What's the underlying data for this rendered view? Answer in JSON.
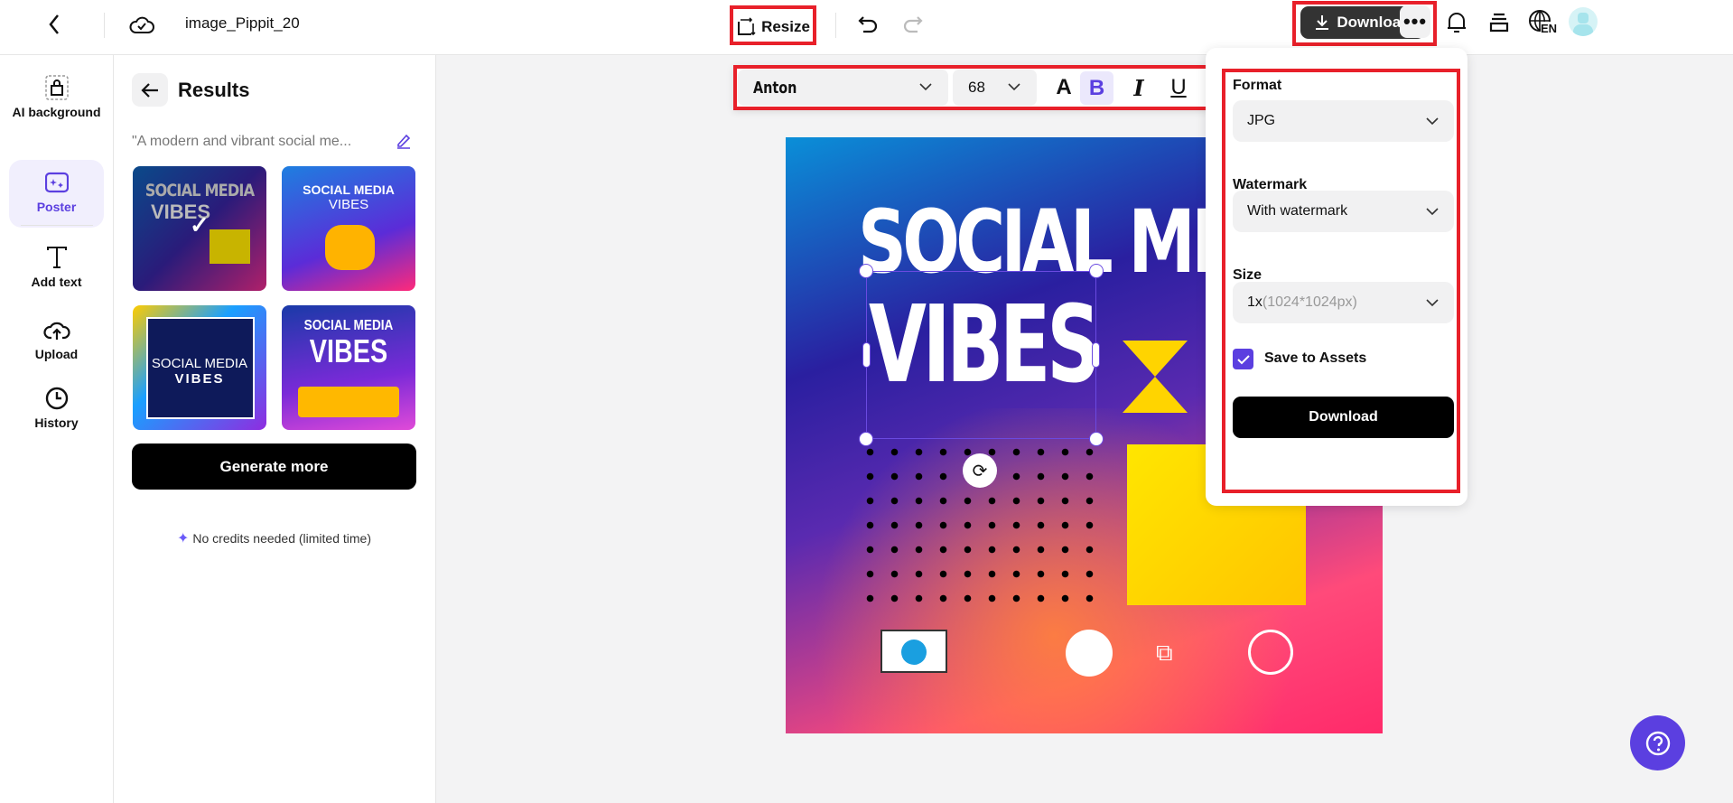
{
  "header": {
    "file_name": "image_Pippit_20",
    "resize_label": "Resize",
    "download_label": "Download",
    "language": "EN"
  },
  "rail": {
    "items": [
      {
        "label": "AI background",
        "icon": "ai-background-icon"
      },
      {
        "label": "Poster",
        "icon": "poster-icon",
        "active": true
      },
      {
        "label": "Add text",
        "icon": "text-icon"
      },
      {
        "label": "Upload",
        "icon": "upload-icon"
      },
      {
        "label": "History",
        "icon": "history-icon"
      }
    ]
  },
  "panel": {
    "title": "Results",
    "prompt": "\"A modern and vibrant social me...",
    "thumbs": [
      {
        "line1": "SOCIAL MEDIA",
        "line2": "VIBES",
        "selected": true
      },
      {
        "line1": "SOCIAL MEDIA",
        "line2": "VIBES"
      },
      {
        "line1": "SOCIAL MEDIA",
        "line2": "VIBES"
      },
      {
        "line1": "SOCIAL MEDIA",
        "line2": "VIBES"
      }
    ],
    "generate_label": "Generate more",
    "credits_note": "No credits needed (limited time)"
  },
  "text_toolbar": {
    "font": "Anton",
    "size": "68"
  },
  "poster": {
    "line1": "SOCIAL ME",
    "line2": "VIBES"
  },
  "download_panel": {
    "format_label": "Format",
    "format_value": "JPG",
    "watermark_label": "Watermark",
    "watermark_value": "With watermark",
    "size_label": "Size",
    "size_value": "1x",
    "size_detail": "(1024*1024px)",
    "save_assets_label": "Save to Assets",
    "save_assets_checked": true,
    "download_label": "Download"
  },
  "colors": {
    "accent": "#5b3fe0",
    "highlight": "#e8202a"
  }
}
